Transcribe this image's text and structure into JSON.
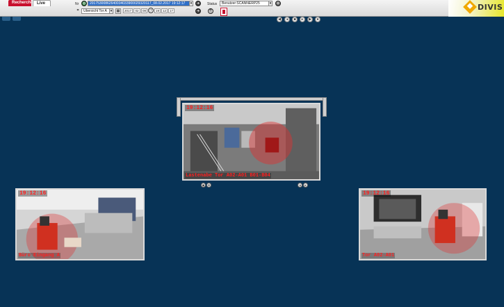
{
  "tabs": {
    "recherche": "Recherche",
    "live": "Live"
  },
  "toolbar": {
    "nr_label": "Nr",
    "nr_value": "20175300862640034033900029320117_08.02.2017 19:12:17",
    "status_label": "Status",
    "status_value": "Benutzer:SCANNERP25",
    "view_select": "Übersicht Tor A",
    "date_year": "2017",
    "date_month": "02",
    "date_day": "08",
    "time_h": "19",
    "time_m": "12",
    "time_s": "17"
  },
  "brand": "DIVIS",
  "cameras": {
    "center": {
      "timestamp": "19:12:16",
      "caption": "Lastenabe Tor A02-A01 B01-B04"
    },
    "left": {
      "timestamp": "19:12:16",
      "caption": "Büro Eingang A"
    },
    "right": {
      "timestamp": "19:12:16",
      "caption": "Tor A02-A01"
    }
  },
  "colors": {
    "background": "#073356",
    "accent": "#c8102e",
    "overlay": "#e03030"
  }
}
